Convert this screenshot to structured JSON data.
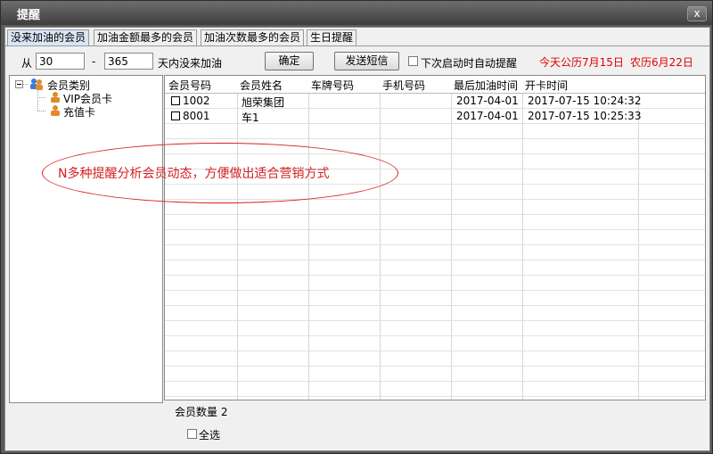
{
  "window": {
    "title": "提醒",
    "close_glyph": "x"
  },
  "tabs": [
    "没来加油的会员",
    "加油金额最多的会员",
    "加油次数最多的会员",
    "生日提醒"
  ],
  "filter": {
    "from_label": "从",
    "from_value": "30",
    "dash": "-",
    "to_value": "365",
    "days_label": "天内没来加油",
    "confirm_button": "确定",
    "sms_button": "发送短信",
    "auto_remind_label": "下次启动时自动提醒",
    "today_label": "今天公历7月15日",
    "lunar_label": "农历6月22日"
  },
  "tree": {
    "root": "会员类别",
    "children": [
      "VIP会员卡",
      "充值卡"
    ]
  },
  "table": {
    "columns": [
      "会员号码",
      "会员姓名",
      "车牌号码",
      "手机号码",
      "最后加油时间",
      "开卡时间"
    ],
    "rows": [
      {
        "id": "1002",
        "name": "旭荣集团",
        "plate": "",
        "phone": "",
        "last_fuel": "2017-04-01",
        "open_time": "2017-07-15 10:24:32"
      },
      {
        "id": "8001",
        "name": "车1",
        "plate": "",
        "phone": "",
        "last_fuel": "2017-04-01",
        "open_time": "2017-07-15 10:25:33"
      }
    ]
  },
  "footer": {
    "member_count_label": "会员数量 2",
    "select_all_label": "全选"
  },
  "annotation": {
    "text": "N多种提醒分析会员动态，方便做出适合营销方式",
    "color": "#d62020"
  }
}
